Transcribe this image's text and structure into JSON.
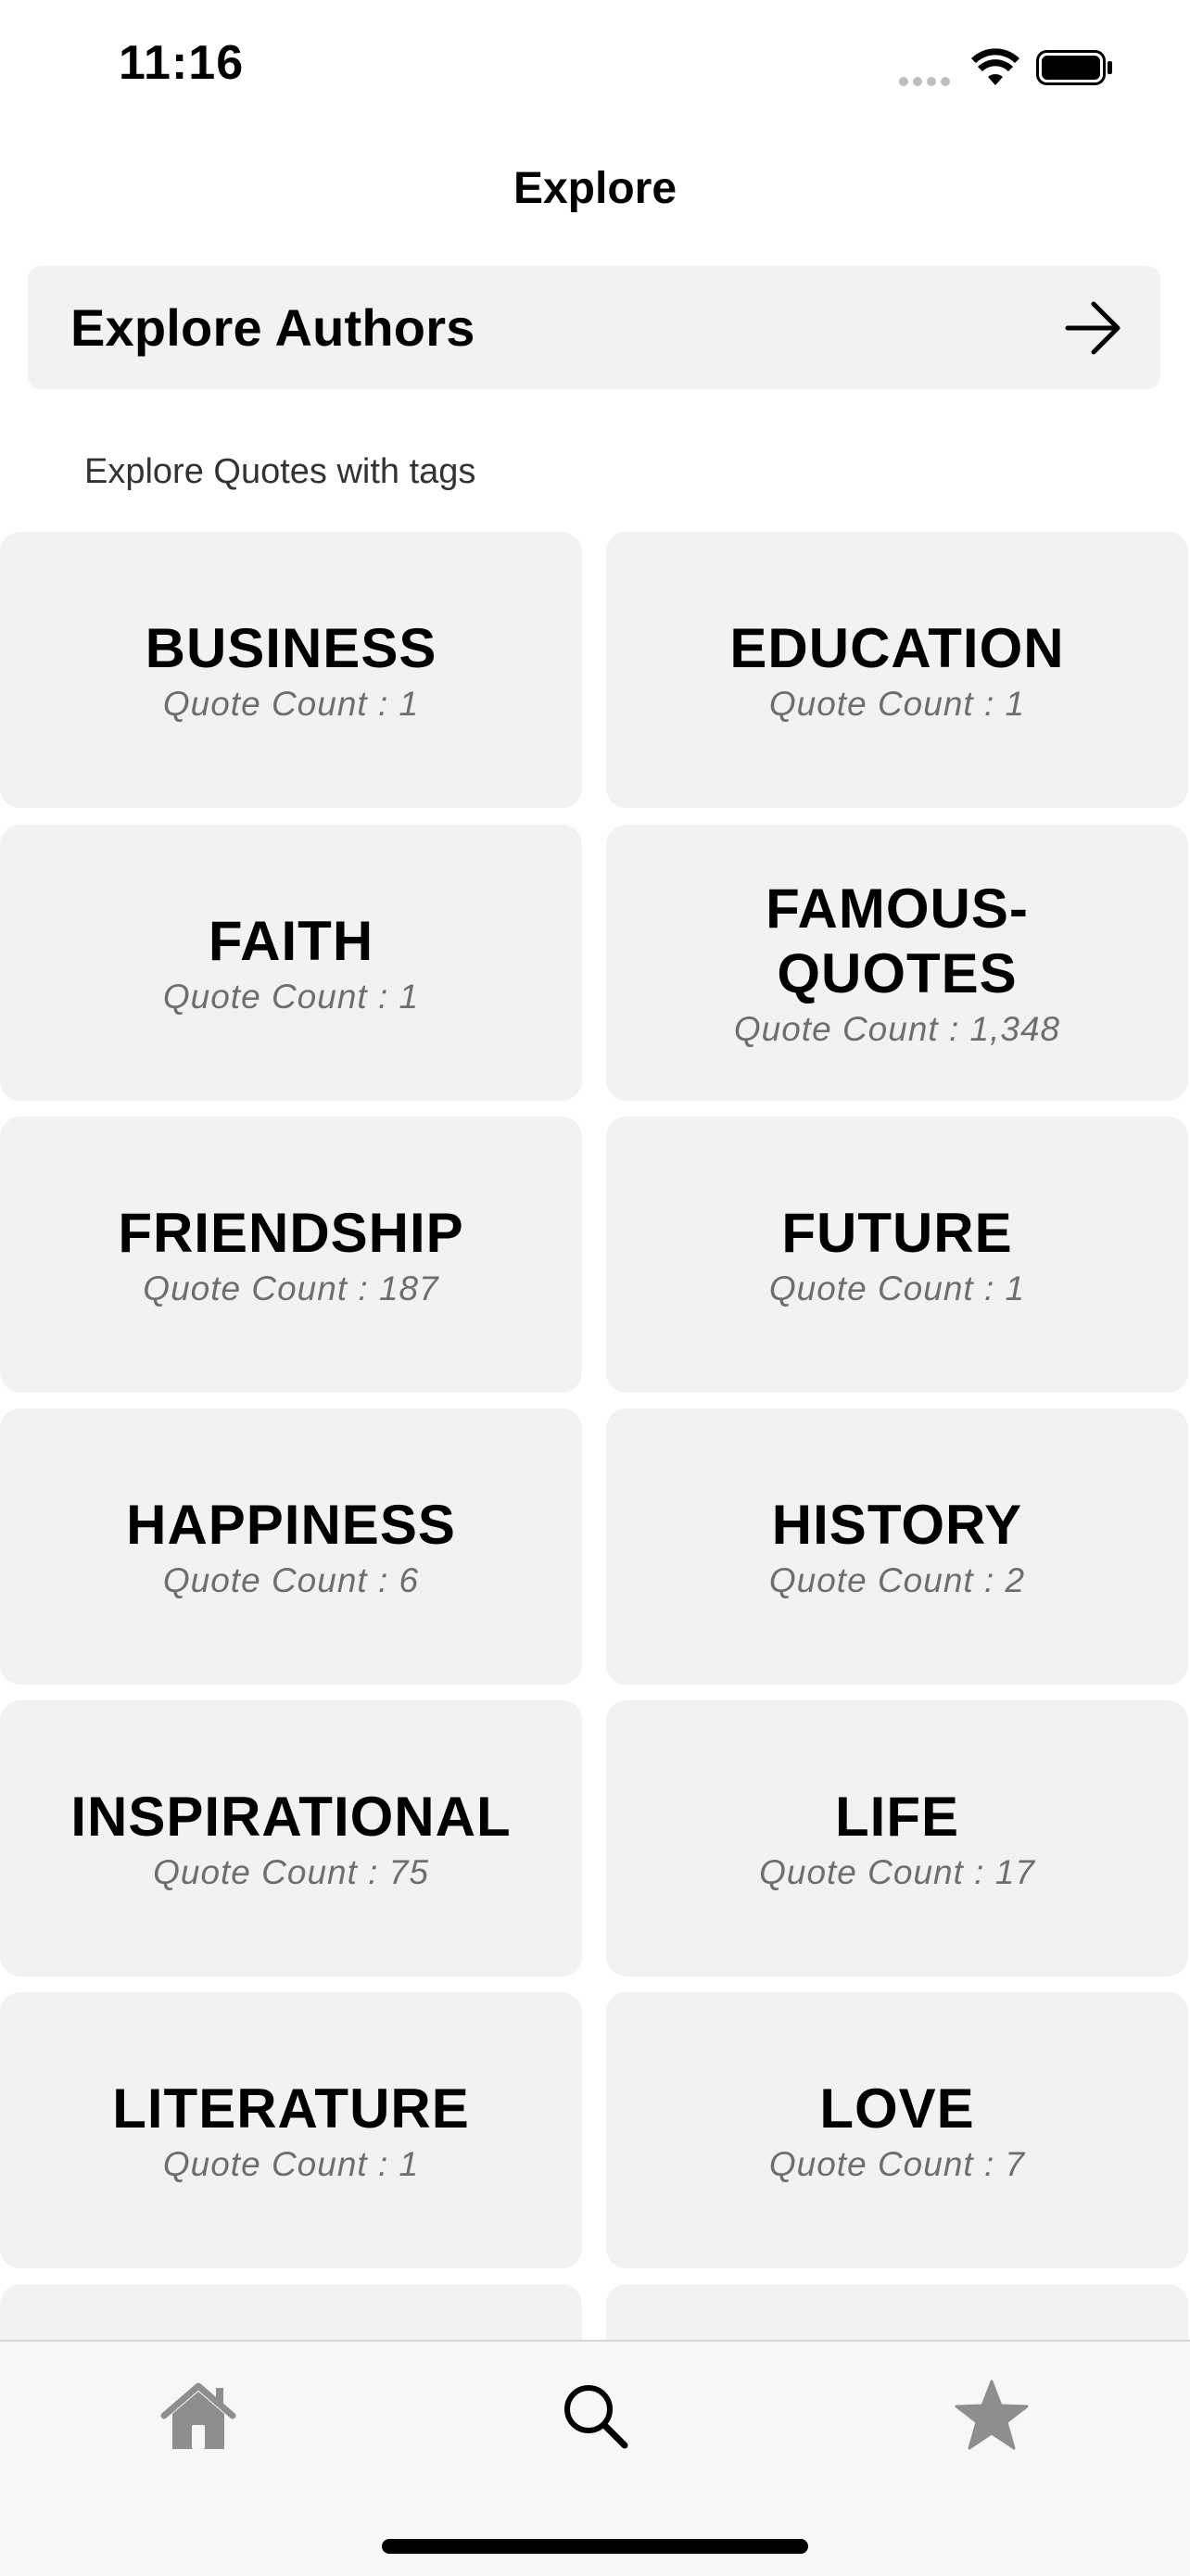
{
  "status_bar": {
    "time": "11:16"
  },
  "nav": {
    "title": "Explore"
  },
  "authors_link": {
    "label": "Explore Authors"
  },
  "section": {
    "label": "Explore Quotes with tags"
  },
  "tags": [
    {
      "name": "BUSINESS",
      "count": "Quote Count : 1"
    },
    {
      "name": "EDUCATION",
      "count": "Quote Count : 1"
    },
    {
      "name": "FAITH",
      "count": "Quote Count : 1"
    },
    {
      "name": "FAMOUS-QUOTES",
      "count": "Quote Count : 1,348"
    },
    {
      "name": "FRIENDSHIP",
      "count": "Quote Count : 187"
    },
    {
      "name": "FUTURE",
      "count": "Quote Count : 1"
    },
    {
      "name": "HAPPINESS",
      "count": "Quote Count : 6"
    },
    {
      "name": "HISTORY",
      "count": "Quote Count : 2"
    },
    {
      "name": "INSPIRATIONAL",
      "count": "Quote Count : 75"
    },
    {
      "name": "LIFE",
      "count": "Quote Count : 17"
    },
    {
      "name": "LITERATURE",
      "count": "Quote Count : 1"
    },
    {
      "name": "LOVE",
      "count": "Quote Count : 7"
    }
  ],
  "tab_bar": {
    "items": [
      {
        "icon": "home-icon",
        "selected": false
      },
      {
        "icon": "search-icon",
        "selected": true
      },
      {
        "icon": "star-icon",
        "selected": false
      }
    ]
  },
  "colors": {
    "card_bg": "#f2f2f2",
    "inactive_icon": "#8e8e8e",
    "active_icon": "#000000"
  }
}
